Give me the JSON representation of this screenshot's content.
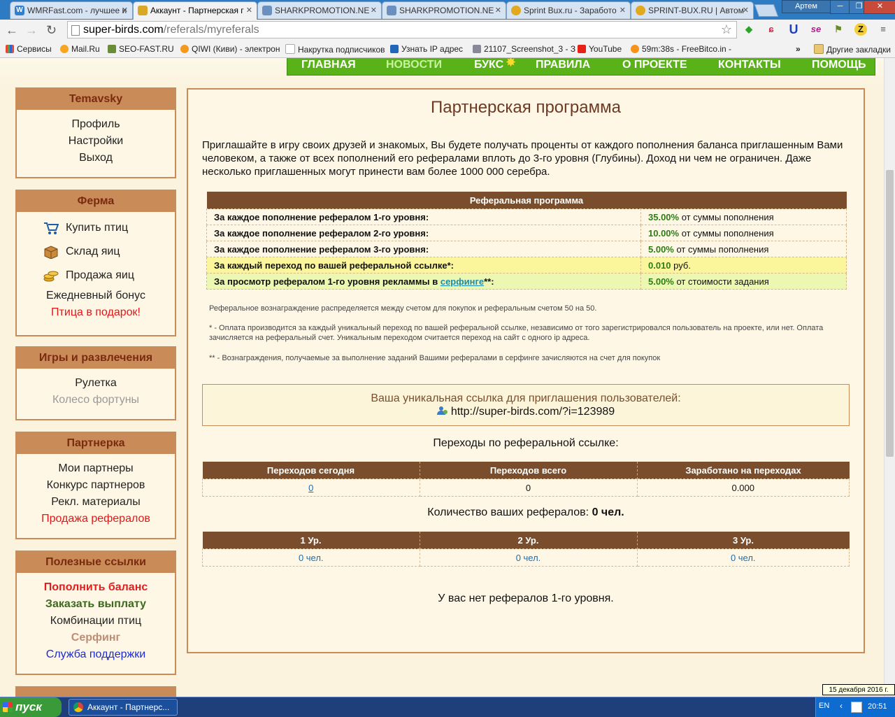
{
  "browser": {
    "tabs": [
      {
        "label": "WMRFast.com - лучшее и",
        "icon_color": "#2f7fd3",
        "icon_glyph": "W"
      },
      {
        "label": "Аккаунт - Партнерская г",
        "icon_color": "#d9a826",
        "icon_glyph": ""
      },
      {
        "label": "SHARKPROMOTION.NE",
        "icon_color": "#6b8fbf",
        "icon_glyph": ""
      },
      {
        "label": "SHARKPROMOTION.NE",
        "icon_color": "#6b8fbf",
        "icon_glyph": ""
      },
      {
        "label": "Sprint Bux.ru - Заработо",
        "icon_color": "#e2a91f",
        "icon_glyph": ""
      },
      {
        "label": "SPRINT-BUX.RU | Автом",
        "icon_color": "#e2a91f",
        "icon_glyph": ""
      }
    ],
    "user_name": "Артем",
    "url_host": "super-birds.com",
    "url_path": "/referals/myreferals",
    "bookmarks": [
      "Сервисы",
      "Mail.Ru",
      "SEO-FAST.RU",
      "QIWI (Киви) - электрон",
      "Накрутка подписчиков",
      "Узнать IP адрес",
      "21107_Screenshot_3 - З",
      "YouTube",
      "59m:38s - FreeBitco.in -"
    ],
    "bookmarks_overflow": "»",
    "other_bookmarks": "Другие закладки"
  },
  "topnav": {
    "items": [
      "ГЛАВНАЯ",
      "НОВОСТИ",
      "БУКС",
      "ПРАВИЛА",
      "О ПРОЕКТЕ",
      "КОНТАКТЫ",
      "ПОМОЩЬ"
    ]
  },
  "sidebar": {
    "user": {
      "title": "Temavsky",
      "items": [
        "Профиль",
        "Настройки",
        "Выход"
      ]
    },
    "farm": {
      "title": "Ферма",
      "icon_items": [
        "Купить птиц",
        "Склад яиц",
        "Продажа яиц"
      ],
      "items": [
        "Ежедневный бонус"
      ],
      "highlight": "Птица в подарок!"
    },
    "games": {
      "title": "Игры и развлечения",
      "items": [
        "Рулетка"
      ],
      "disabled": "Колесо фортуны"
    },
    "partners": {
      "title": "Партнерка",
      "items": [
        "Мои партнеры",
        "Конкурс партнеров",
        "Рекл. материалы"
      ],
      "highlight": "Продажа рефералов"
    },
    "useful": {
      "title": "Полезные ссылки",
      "deposit": "Пополнить баланс",
      "withdraw": "Заказать выплату",
      "combos": "Комбинации птиц",
      "surf": "Серфинг",
      "support": "Служба поддержки"
    }
  },
  "main": {
    "title": "Партнерская программа",
    "intro": "Приглашайте в игру своих друзей и знакомых, Вы будете получать проценты от каждого пополнения баланса приглашенным Вами человеком, а также от всех пополнений его рефералами вплоть до 3-го уровня (Глубины). Доход ни чем не ограничен. Даже несколько приглашенных могут принести вам более 1000 000 серебра.",
    "ref_table": {
      "header": "Реферальная программа",
      "rows": [
        {
          "label": "За каждое пополнение рефералом 1-го уровня:",
          "value": "35.00%",
          "suffix": " от суммы пополнения"
        },
        {
          "label": "За каждое пополнение рефералом 2-го уровня:",
          "value": "10.00%",
          "suffix": " от суммы пополнения"
        },
        {
          "label": "За каждое пополнение рефералом 3-го уровня:",
          "value": "5.00%",
          "suffix": " от суммы пополнения"
        },
        {
          "label": "За каждый переход по вашей реферальной ссылке*:",
          "value": "0.010",
          "suffix": " руб."
        }
      ],
      "surf_row": {
        "label_before": "За просмотр рефералом 1-го уровня рекламмы в ",
        "link": "серфинге",
        "label_after": "**:",
        "value": "5.00%",
        "suffix": " от стоимости задания"
      }
    },
    "notes": [
      "Реферальное вознаграждение распределяется между счетом для покупок и реферальным счетом 50 на 50.",
      "* - Оплата производится за каждый уникальный переход по вашей реферальной ссылке, независимо от того зарегистрировался пользователь на проекте, или нет. Оплата зачисляется на реферальный счет. Уникальным переходом считается переход на сайт с одного ip адреса.",
      "** - Вознаграждения, получаемые за выполнение заданий Вашими рефералами в серфинге зачисляются на счет для покупок"
    ],
    "link_box": {
      "title": "Ваша уникальная ссылка для приглашения пользователей:",
      "url": "http://super-birds.com/?i=123989"
    },
    "clicks_label": "Переходы по реферальной ссылке:",
    "clicks_table": {
      "headers": [
        "Переходов сегодня",
        "Переходов всего",
        "Заработано на переходах"
      ],
      "values": [
        "0",
        "0",
        "0.000"
      ]
    },
    "referrals_label": "Количество ваших рефералов:",
    "referrals_count": "0 чел.",
    "levels_table": {
      "headers": [
        "1 Ур.",
        "2 Ур.",
        "3 Ур."
      ],
      "values": [
        "0 чел.",
        "0 чел.",
        "0 чел."
      ]
    },
    "empty_message": "У вас нет рефералов 1-го уровня."
  },
  "taskbar": {
    "start": "пуск",
    "task": "Аккаунт - Партнерс...",
    "lang": "EN",
    "time": "20:51",
    "date_tooltip": "15 декабря 2016 г."
  }
}
